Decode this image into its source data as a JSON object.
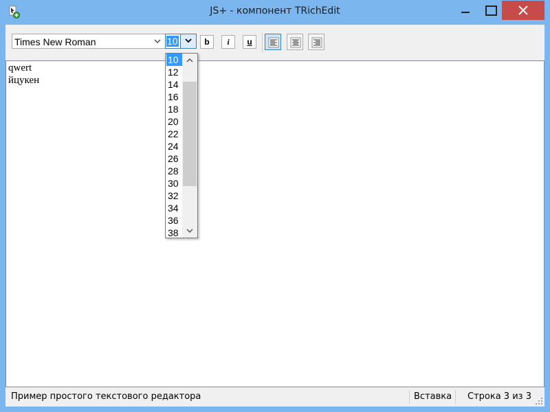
{
  "window": {
    "title": "JS+ - компонент TRichEdit",
    "icon": "app-icon",
    "frame_color": "#7cb6ee",
    "close_color": "#c74b49"
  },
  "toolbar": {
    "font_name": "Times New Roman",
    "font_size": "10",
    "bold_label": "b",
    "italic_label": "i",
    "underline_label": "u",
    "align_active": "left"
  },
  "size_dropdown": {
    "items": [
      "10",
      "12",
      "14",
      "16",
      "18",
      "20",
      "22",
      "24",
      "26",
      "28",
      "30",
      "32",
      "34",
      "36",
      "38"
    ],
    "selected": "10"
  },
  "editor": {
    "lines": [
      "qwert",
      "йцукен"
    ]
  },
  "statusbar": {
    "panel1": "Пример простого текстового редактора",
    "panel2": "Вставка",
    "panel3": "Строка 3 из 3"
  }
}
